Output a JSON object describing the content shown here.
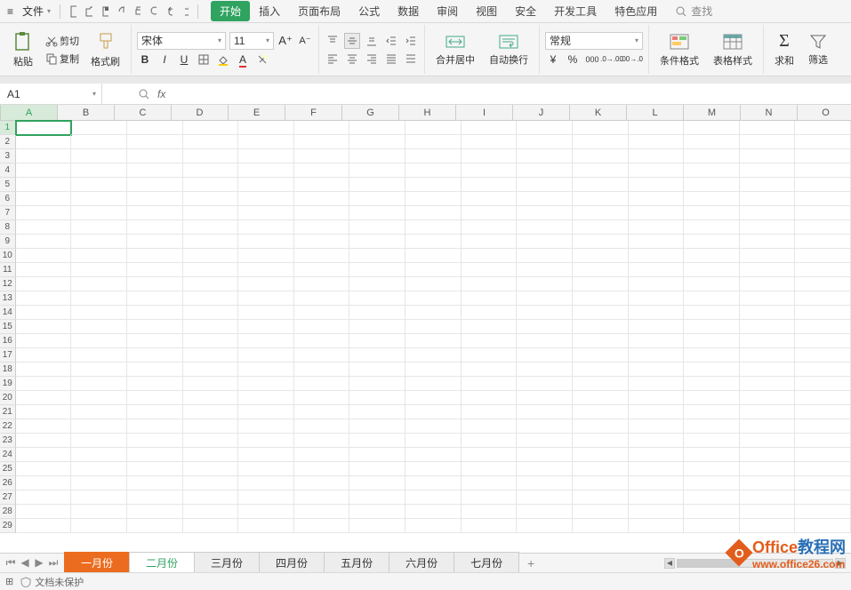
{
  "qa": {
    "menu_icon": "≡",
    "file_label": "文件",
    "search_label": "查找"
  },
  "menu": [
    "开始",
    "插入",
    "页面布局",
    "公式",
    "数据",
    "审阅",
    "视图",
    "安全",
    "开发工具",
    "特色应用"
  ],
  "ribbon": {
    "paste": "粘贴",
    "cut": "剪切",
    "copy": "复制",
    "format_painter": "格式刷",
    "font_name": "宋体",
    "font_size": "11",
    "merge": "合并居中",
    "wrap": "自动换行",
    "num_format": "常规",
    "cond_format": "条件格式",
    "table_style": "表格样式",
    "sum": "求和",
    "filter": "筛选"
  },
  "name_box": "A1",
  "columns": [
    "A",
    "B",
    "C",
    "D",
    "E",
    "F",
    "G",
    "H",
    "I",
    "J",
    "K",
    "L",
    "M",
    "N",
    "O"
  ],
  "row_count": 29,
  "sheet_tabs": [
    "一月份",
    "二月份",
    "三月份",
    "四月份",
    "五月份",
    "六月份",
    "七月份"
  ],
  "status": {
    "protect": "文档未保护"
  },
  "watermark": {
    "line1a": "Office",
    "line1b": "教程网",
    "line2": "www.office26.com"
  }
}
